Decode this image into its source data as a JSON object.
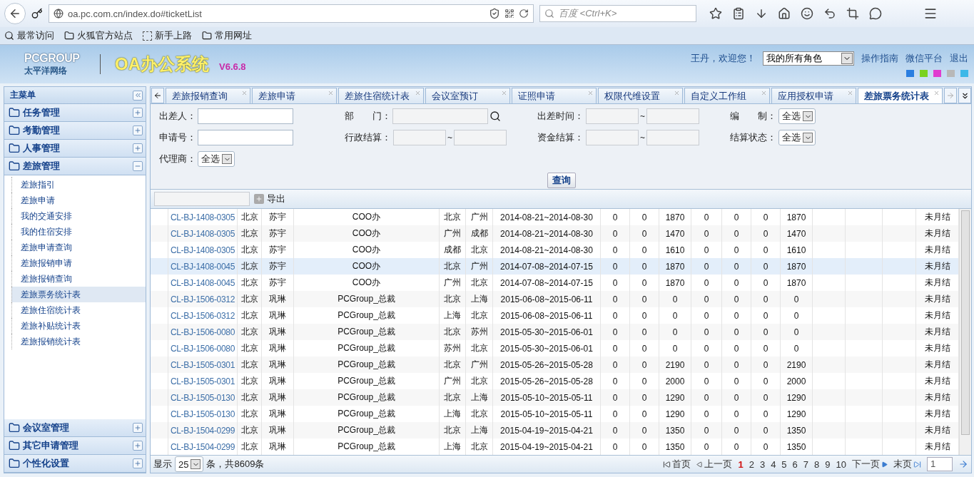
{
  "browser": {
    "url": "oa.pc.com.cn/index.do#ticketList",
    "search_placeholder": "百度 <Ctrl+K>",
    "bookmarks": [
      {
        "label": "最常访问",
        "kind": "search"
      },
      {
        "label": "火狐官方站点",
        "kind": "folder"
      },
      {
        "label": "新手上路",
        "kind": "dashed"
      },
      {
        "label": "常用网址",
        "kind": "folder"
      }
    ]
  },
  "header": {
    "logo": "PCGROUP",
    "logo_sub": "太平洋网络",
    "title": "OA办公系统",
    "version": "V6.6.8",
    "greeting": "王丹，欢迎您！",
    "role": "我的所有角色",
    "links": [
      "操作指南",
      "微信平台",
      "退出"
    ],
    "themes": [
      {
        "color": "#2a7ee0"
      },
      {
        "color": "#7ad21e"
      },
      {
        "color": "#e03ccf"
      },
      {
        "color": "#b8b8b8"
      },
      {
        "color": "#3cb8e8"
      }
    ]
  },
  "sidebar": {
    "title": "主菜单",
    "groups": [
      {
        "label": "任务管理",
        "expanded": false
      },
      {
        "label": "考勤管理",
        "expanded": false
      },
      {
        "label": "人事管理",
        "expanded": false
      },
      {
        "label": "差旅管理",
        "expanded": true,
        "children": [
          {
            "label": "差旅指引",
            "selected": false
          },
          {
            "label": "差旅申请",
            "selected": false
          },
          {
            "label": "我的交通安排",
            "selected": false
          },
          {
            "label": "我的住宿安排",
            "selected": false
          },
          {
            "label": "差旅申请查询",
            "selected": false
          },
          {
            "label": "差旅报销申请",
            "selected": false
          },
          {
            "label": "差旅报销查询",
            "selected": false
          },
          {
            "label": "差旅票务统计表",
            "selected": true
          },
          {
            "label": "差旅住宿统计表",
            "selected": false
          },
          {
            "label": "差旅补贴统计表",
            "selected": false
          },
          {
            "label": "差旅报销统计表",
            "selected": false
          }
        ]
      },
      {
        "label": "会议室管理",
        "expanded": false
      },
      {
        "label": "其它申请管理",
        "expanded": false
      },
      {
        "label": "个性化设置",
        "expanded": false
      }
    ]
  },
  "tabs": [
    {
      "label": "差旅报销查询",
      "selected": false
    },
    {
      "label": "差旅申请",
      "selected": false
    },
    {
      "label": "差旅住宿统计表",
      "selected": false
    },
    {
      "label": "会议室预订",
      "selected": false
    },
    {
      "label": "证照申请",
      "selected": false
    },
    {
      "label": "权限代维设置",
      "selected": false
    },
    {
      "label": "自定义工作组",
      "selected": false
    },
    {
      "label": "应用授权申请",
      "selected": false
    },
    {
      "label": "差旅票务统计表",
      "selected": true
    }
  ],
  "filters": [
    {
      "label": "出差人：",
      "kind": "text",
      "disabled": false
    },
    {
      "label": "部　　门：",
      "kind": "lookup",
      "disabled": true
    },
    {
      "label": "出差时间：",
      "kind": "range",
      "separator": "~",
      "disabled": true
    },
    {
      "label": "编　　制：",
      "kind": "select",
      "value": "全选"
    },
    {
      "label": "申请号：",
      "kind": "text",
      "disabled": false
    },
    {
      "label": "行政结算：",
      "kind": "range",
      "separator": "~",
      "disabled": true
    },
    {
      "label": "资金结算：",
      "kind": "range",
      "separator": "~",
      "disabled": true
    },
    {
      "label": "结算状态：",
      "kind": "select",
      "value": "全选"
    },
    {
      "label": "代理商：",
      "kind": "select",
      "value": "全选"
    }
  ],
  "query_button": "查询",
  "export_button": "导出",
  "rows": [
    {
      "selected": false,
      "cells": [
        "CL-BJ-1408-0305",
        "北京",
        "苏宇",
        "COO办",
        "北京",
        "广州",
        "2014-08-21~2014-08-30",
        "0",
        "0",
        "1870",
        "0",
        "0",
        "0",
        "1870",
        "未月结"
      ]
    },
    {
      "selected": false,
      "cells": [
        "CL-BJ-1408-0305",
        "北京",
        "苏宇",
        "COO办",
        "广州",
        "成都",
        "2014-08-21~2014-08-30",
        "0",
        "0",
        "1470",
        "0",
        "0",
        "0",
        "1470",
        "未月结"
      ]
    },
    {
      "selected": false,
      "cells": [
        "CL-BJ-1408-0305",
        "北京",
        "苏宇",
        "COO办",
        "成都",
        "北京",
        "2014-08-21~2014-08-30",
        "0",
        "0",
        "1610",
        "0",
        "0",
        "0",
        "1610",
        "未月结"
      ]
    },
    {
      "selected": true,
      "cells": [
        "CL-BJ-1408-0045",
        "北京",
        "苏宇",
        "COO办",
        "北京",
        "广州",
        "2014-07-08~2014-07-15",
        "0",
        "0",
        "1870",
        "0",
        "0",
        "0",
        "1870",
        "未月结"
      ]
    },
    {
      "selected": false,
      "cells": [
        "CL-BJ-1408-0045",
        "北京",
        "苏宇",
        "COO办",
        "广州",
        "北京",
        "2014-07-08~2014-07-15",
        "0",
        "0",
        "1870",
        "0",
        "0",
        "0",
        "1870",
        "未月结"
      ]
    },
    {
      "selected": false,
      "cells": [
        "CL-BJ-1506-0312",
        "北京",
        "巩琳",
        "PCGroup_总裁",
        "北京",
        "上海",
        "2015-06-08~2015-06-11",
        "0",
        "0",
        "0",
        "0",
        "0",
        "0",
        "0",
        "未月结"
      ]
    },
    {
      "selected": false,
      "cells": [
        "CL-BJ-1506-0312",
        "北京",
        "巩琳",
        "PCGroup_总裁",
        "上海",
        "北京",
        "2015-06-08~2015-06-11",
        "0",
        "0",
        "0",
        "0",
        "0",
        "0",
        "0",
        "未月结"
      ]
    },
    {
      "selected": false,
      "cells": [
        "CL-BJ-1506-0080",
        "北京",
        "巩琳",
        "PCGroup_总裁",
        "北京",
        "苏州",
        "2015-05-30~2015-06-01",
        "0",
        "0",
        "0",
        "0",
        "0",
        "0",
        "0",
        "未月结"
      ]
    },
    {
      "selected": false,
      "cells": [
        "CL-BJ-1506-0080",
        "北京",
        "巩琳",
        "PCGroup_总裁",
        "苏州",
        "北京",
        "2015-05-30~2015-06-01",
        "0",
        "0",
        "0",
        "0",
        "0",
        "0",
        "0",
        "未月结"
      ]
    },
    {
      "selected": false,
      "cells": [
        "CL-BJ-1505-0301",
        "北京",
        "巩琳",
        "PCGroup_总裁",
        "北京",
        "广州",
        "2015-05-26~2015-05-28",
        "0",
        "0",
        "2190",
        "0",
        "0",
        "0",
        "2190",
        "未月结"
      ]
    },
    {
      "selected": false,
      "cells": [
        "CL-BJ-1505-0301",
        "北京",
        "巩琳",
        "PCGroup_总裁",
        "广州",
        "北京",
        "2015-05-26~2015-05-28",
        "0",
        "0",
        "2000",
        "0",
        "0",
        "0",
        "2000",
        "未月结"
      ]
    },
    {
      "selected": false,
      "cells": [
        "CL-BJ-1505-0130",
        "北京",
        "巩琳",
        "PCGroup_总裁",
        "北京",
        "上海",
        "2015-05-10~2015-05-11",
        "0",
        "0",
        "1290",
        "0",
        "0",
        "0",
        "1290",
        "未月结"
      ]
    },
    {
      "selected": false,
      "cells": [
        "CL-BJ-1505-0130",
        "北京",
        "巩琳",
        "PCGroup_总裁",
        "上海",
        "北京",
        "2015-05-10~2015-05-11",
        "0",
        "0",
        "1290",
        "0",
        "0",
        "0",
        "1290",
        "未月结"
      ]
    },
    {
      "selected": false,
      "cells": [
        "CL-BJ-1504-0299",
        "北京",
        "巩琳",
        "PCGroup_总裁",
        "北京",
        "上海",
        "2015-04-19~2015-04-21",
        "0",
        "0",
        "1350",
        "0",
        "0",
        "0",
        "1350",
        "未月结"
      ]
    },
    {
      "selected": false,
      "cells": [
        "CL-BJ-1504-0299",
        "北京",
        "巩琳",
        "PCGroup_总裁",
        "上海",
        "北京",
        "2015-04-19~2015-04-21",
        "0",
        "0",
        "1350",
        "0",
        "0",
        "0",
        "1350",
        "未月结"
      ]
    }
  ],
  "footer": {
    "show": "显示",
    "page_size": "25",
    "total": "条，共8609条",
    "first": "首页",
    "prev": "上一页",
    "pages": [
      {
        "label": "1",
        "selected": true
      },
      {
        "label": "2",
        "selected": false
      },
      {
        "label": "3",
        "selected": false
      },
      {
        "label": "4",
        "selected": false
      },
      {
        "label": "5",
        "selected": false
      },
      {
        "label": "6",
        "selected": false
      },
      {
        "label": "7",
        "selected": false
      },
      {
        "label": "8",
        "selected": false
      },
      {
        "label": "9",
        "selected": false
      },
      {
        "label": "10",
        "selected": false
      }
    ],
    "next": "下一页",
    "last": "末页",
    "page_input": "1"
  }
}
